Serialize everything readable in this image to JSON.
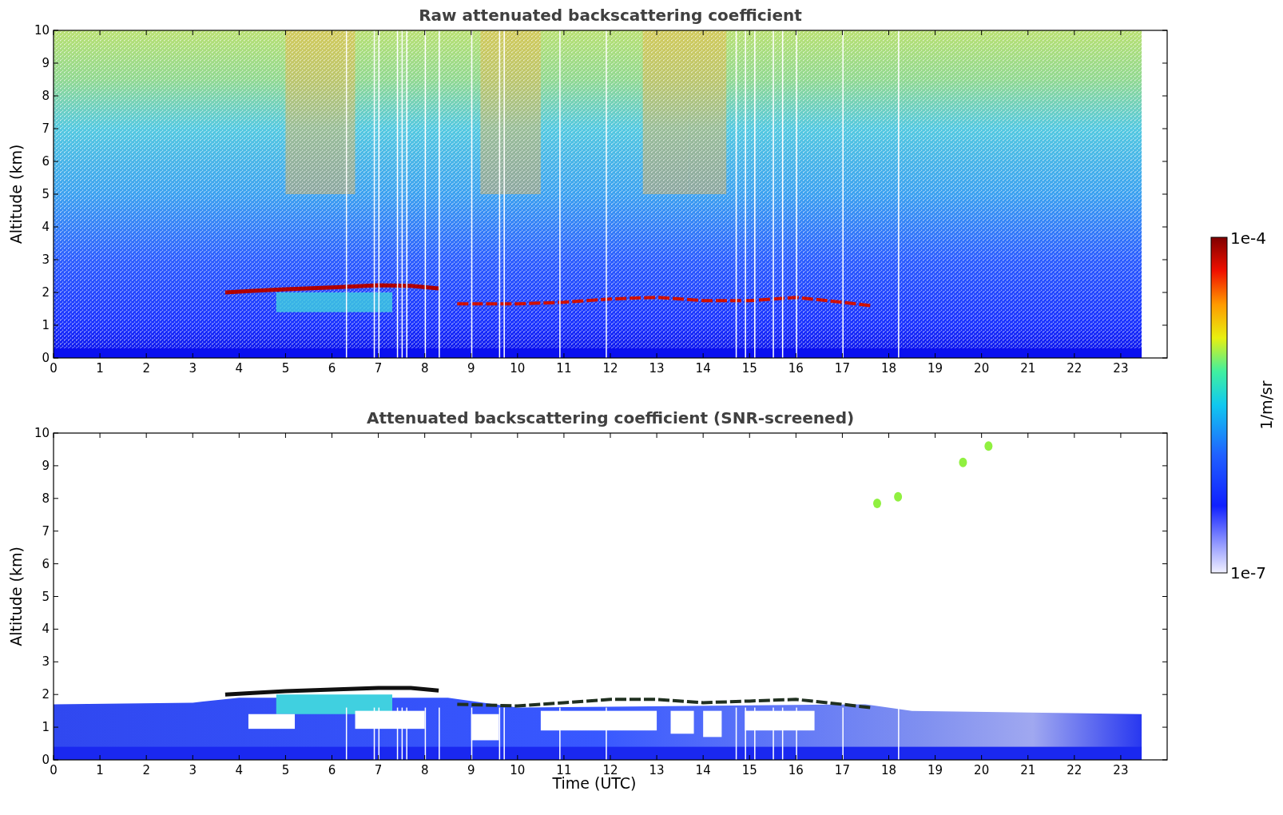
{
  "panels": [
    {
      "kind": "raw",
      "title": "Raw attenuated backscattering coefficient",
      "ylabel": "Altitude (km)",
      "yticks": [
        "10",
        "9",
        "8",
        "7",
        "6",
        "5",
        "4",
        "3",
        "2",
        "1",
        "0"
      ],
      "xticks": [
        "0",
        "1",
        "2",
        "3",
        "4",
        "5",
        "6",
        "7",
        "8",
        "9",
        "10",
        "11",
        "12",
        "13",
        "14",
        "15",
        "16",
        "17",
        "18",
        "19",
        "20",
        "21",
        "22",
        "23"
      ]
    },
    {
      "kind": "screened",
      "title": "Attenuated backscattering coefficient (SNR-screened)",
      "ylabel": "Altitude (km)",
      "xlabel": "Time (UTC)",
      "yticks": [
        "10",
        "9",
        "8",
        "7",
        "6",
        "5",
        "4",
        "3",
        "2",
        "1",
        "0"
      ],
      "xticks": [
        "0",
        "1",
        "2",
        "3",
        "4",
        "5",
        "6",
        "7",
        "8",
        "9",
        "10",
        "11",
        "12",
        "13",
        "14",
        "15",
        "16",
        "17",
        "18",
        "19",
        "20",
        "21",
        "22",
        "23"
      ]
    }
  ],
  "colorbar": {
    "max_label": "1e-4",
    "min_label": "1e-7",
    "label": "1/m/sr"
  }
}
